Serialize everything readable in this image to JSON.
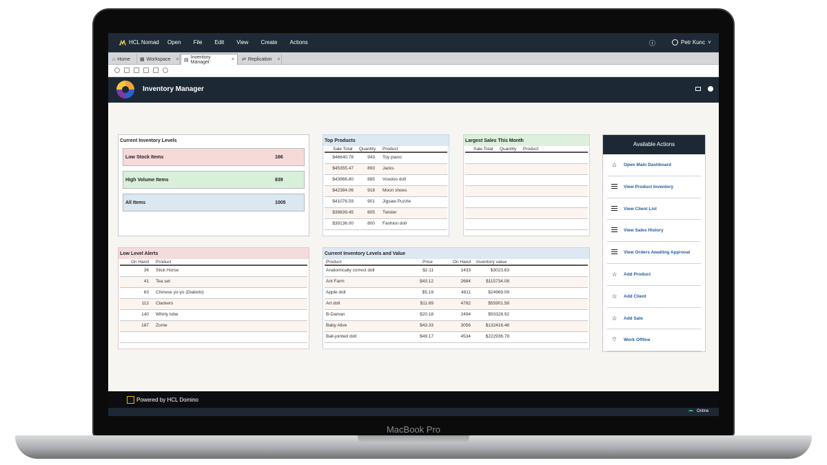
{
  "device_label": "MacBook Pro",
  "appbar": {
    "brand": "HCL Nomad",
    "menu": [
      "Open",
      "File",
      "Edit",
      "View",
      "Create",
      "Actions"
    ],
    "help": "?",
    "user": "Petr Kunc"
  },
  "tabs": [
    {
      "label": "Home"
    },
    {
      "label": "Workspace"
    },
    {
      "label": "Inventory Manager"
    },
    {
      "label": "Replication"
    }
  ],
  "app": {
    "title": "Inventory Manager"
  },
  "current_inventory": {
    "title": "Current Inventory Levels",
    "kpis": [
      {
        "label": "Low Stock Items",
        "value": "166",
        "color": "#f6dada"
      },
      {
        "label": "High Volume Items",
        "value": "839",
        "color": "#d8efd9"
      },
      {
        "label": "All Items",
        "value": "1005",
        "color": "#dbe7f1"
      }
    ]
  },
  "top_products": {
    "title": "Top Products",
    "headers": [
      "Sale Total",
      "Quantity",
      "Product"
    ],
    "rows": [
      [
        "$46640.78",
        "943",
        "Toy piano"
      ],
      [
        "$45355.47",
        "893",
        "Jacks"
      ],
      [
        "$43966.80",
        "885",
        "Voodoo doll"
      ],
      [
        "$42384.06",
        "918",
        "Moon shoes"
      ],
      [
        "$41076.59",
        "901",
        "Jigsaw Puzzle"
      ],
      [
        "$39839.45",
        "805",
        "Twister"
      ],
      [
        "$39136.00",
        "800",
        "Fashion doll"
      ]
    ]
  },
  "largest_sales": {
    "title": "Largest Sales This Month",
    "headers": [
      "Sale Total",
      "Quantity",
      "Product"
    ]
  },
  "low_alerts": {
    "title": "Low Level Alerts",
    "headers": [
      "On Hand",
      "Product"
    ],
    "rows": [
      [
        "36",
        "Stick Horse"
      ],
      [
        "41",
        "Tea set"
      ],
      [
        "63",
        "Chinese yo-yo (Diabolo)"
      ],
      [
        "112",
        "Clackers"
      ],
      [
        "140",
        "Whirly tube"
      ],
      [
        "187",
        "Zome"
      ]
    ]
  },
  "levels_value": {
    "title": "Current Inventory Levels and Value",
    "headers": [
      "Product",
      "Price",
      "On Hand",
      "Inventory value"
    ],
    "rows": [
      [
        "Anatomically correct doll",
        "$2.11",
        "1433",
        "$3023.63"
      ],
      [
        "Ant Farm",
        "$43.12",
        "2684",
        "$115734.08"
      ],
      [
        "Apple doll",
        "$5.19",
        "4811",
        "$24969.09"
      ],
      [
        "Art doll",
        "$11.69",
        "4782",
        "$55901.58"
      ],
      [
        "B-Daman",
        "$20.18",
        "2494",
        "$50328.92"
      ],
      [
        "Baby Alive",
        "$43.33",
        "3056",
        "$132416.48"
      ],
      [
        "Ball-jointed doll",
        "$49.17",
        "4534",
        "$222936.78"
      ]
    ]
  },
  "actions": {
    "title": "Available Actions",
    "items": [
      {
        "label": "Open Main Dashboard",
        "icon": "home-icon"
      },
      {
        "label": "View Product Inventory",
        "icon": "list-icon"
      },
      {
        "label": "View Client List",
        "icon": "list-icon"
      },
      {
        "label": "View Sales History",
        "icon": "list-icon"
      },
      {
        "label": "View Orders Awaiting Approval",
        "icon": "list-icon"
      },
      {
        "label": "Add Product",
        "icon": "star-icon"
      },
      {
        "label": "Add Client",
        "icon": "star-icon"
      },
      {
        "label": "Add Sale",
        "icon": "star-icon"
      },
      {
        "label": "Work Offline",
        "icon": "wifi-off-icon"
      }
    ]
  },
  "footer": {
    "powered": "Powered by HCL Domino",
    "status": "Online"
  }
}
